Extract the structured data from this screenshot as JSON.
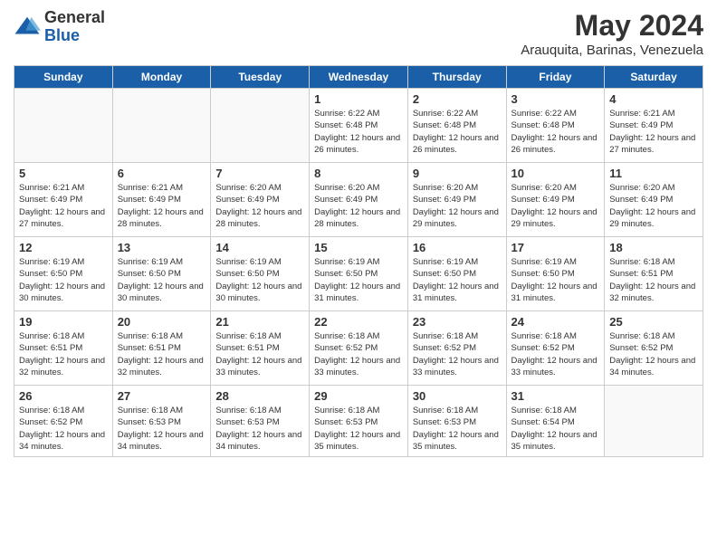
{
  "logo": {
    "general": "General",
    "blue": "Blue"
  },
  "title": "May 2024",
  "subtitle": "Arauquita, Barinas, Venezuela",
  "weekdays": [
    "Sunday",
    "Monday",
    "Tuesday",
    "Wednesday",
    "Thursday",
    "Friday",
    "Saturday"
  ],
  "weeks": [
    [
      {
        "day": "",
        "info": ""
      },
      {
        "day": "",
        "info": ""
      },
      {
        "day": "",
        "info": ""
      },
      {
        "day": "1",
        "info": "Sunrise: 6:22 AM\nSunset: 6:48 PM\nDaylight: 12 hours and 26 minutes."
      },
      {
        "day": "2",
        "info": "Sunrise: 6:22 AM\nSunset: 6:48 PM\nDaylight: 12 hours and 26 minutes."
      },
      {
        "day": "3",
        "info": "Sunrise: 6:22 AM\nSunset: 6:48 PM\nDaylight: 12 hours and 26 minutes."
      },
      {
        "day": "4",
        "info": "Sunrise: 6:21 AM\nSunset: 6:49 PM\nDaylight: 12 hours and 27 minutes."
      }
    ],
    [
      {
        "day": "5",
        "info": "Sunrise: 6:21 AM\nSunset: 6:49 PM\nDaylight: 12 hours and 27 minutes."
      },
      {
        "day": "6",
        "info": "Sunrise: 6:21 AM\nSunset: 6:49 PM\nDaylight: 12 hours and 28 minutes."
      },
      {
        "day": "7",
        "info": "Sunrise: 6:20 AM\nSunset: 6:49 PM\nDaylight: 12 hours and 28 minutes."
      },
      {
        "day": "8",
        "info": "Sunrise: 6:20 AM\nSunset: 6:49 PM\nDaylight: 12 hours and 28 minutes."
      },
      {
        "day": "9",
        "info": "Sunrise: 6:20 AM\nSunset: 6:49 PM\nDaylight: 12 hours and 29 minutes."
      },
      {
        "day": "10",
        "info": "Sunrise: 6:20 AM\nSunset: 6:49 PM\nDaylight: 12 hours and 29 minutes."
      },
      {
        "day": "11",
        "info": "Sunrise: 6:20 AM\nSunset: 6:49 PM\nDaylight: 12 hours and 29 minutes."
      }
    ],
    [
      {
        "day": "12",
        "info": "Sunrise: 6:19 AM\nSunset: 6:50 PM\nDaylight: 12 hours and 30 minutes."
      },
      {
        "day": "13",
        "info": "Sunrise: 6:19 AM\nSunset: 6:50 PM\nDaylight: 12 hours and 30 minutes."
      },
      {
        "day": "14",
        "info": "Sunrise: 6:19 AM\nSunset: 6:50 PM\nDaylight: 12 hours and 30 minutes."
      },
      {
        "day": "15",
        "info": "Sunrise: 6:19 AM\nSunset: 6:50 PM\nDaylight: 12 hours and 31 minutes."
      },
      {
        "day": "16",
        "info": "Sunrise: 6:19 AM\nSunset: 6:50 PM\nDaylight: 12 hours and 31 minutes."
      },
      {
        "day": "17",
        "info": "Sunrise: 6:19 AM\nSunset: 6:50 PM\nDaylight: 12 hours and 31 minutes."
      },
      {
        "day": "18",
        "info": "Sunrise: 6:18 AM\nSunset: 6:51 PM\nDaylight: 12 hours and 32 minutes."
      }
    ],
    [
      {
        "day": "19",
        "info": "Sunrise: 6:18 AM\nSunset: 6:51 PM\nDaylight: 12 hours and 32 minutes."
      },
      {
        "day": "20",
        "info": "Sunrise: 6:18 AM\nSunset: 6:51 PM\nDaylight: 12 hours and 32 minutes."
      },
      {
        "day": "21",
        "info": "Sunrise: 6:18 AM\nSunset: 6:51 PM\nDaylight: 12 hours and 33 minutes."
      },
      {
        "day": "22",
        "info": "Sunrise: 6:18 AM\nSunset: 6:52 PM\nDaylight: 12 hours and 33 minutes."
      },
      {
        "day": "23",
        "info": "Sunrise: 6:18 AM\nSunset: 6:52 PM\nDaylight: 12 hours and 33 minutes."
      },
      {
        "day": "24",
        "info": "Sunrise: 6:18 AM\nSunset: 6:52 PM\nDaylight: 12 hours and 33 minutes."
      },
      {
        "day": "25",
        "info": "Sunrise: 6:18 AM\nSunset: 6:52 PM\nDaylight: 12 hours and 34 minutes."
      }
    ],
    [
      {
        "day": "26",
        "info": "Sunrise: 6:18 AM\nSunset: 6:52 PM\nDaylight: 12 hours and 34 minutes."
      },
      {
        "day": "27",
        "info": "Sunrise: 6:18 AM\nSunset: 6:53 PM\nDaylight: 12 hours and 34 minutes."
      },
      {
        "day": "28",
        "info": "Sunrise: 6:18 AM\nSunset: 6:53 PM\nDaylight: 12 hours and 34 minutes."
      },
      {
        "day": "29",
        "info": "Sunrise: 6:18 AM\nSunset: 6:53 PM\nDaylight: 12 hours and 35 minutes."
      },
      {
        "day": "30",
        "info": "Sunrise: 6:18 AM\nSunset: 6:53 PM\nDaylight: 12 hours and 35 minutes."
      },
      {
        "day": "31",
        "info": "Sunrise: 6:18 AM\nSunset: 6:54 PM\nDaylight: 12 hours and 35 minutes."
      },
      {
        "day": "",
        "info": ""
      }
    ]
  ]
}
